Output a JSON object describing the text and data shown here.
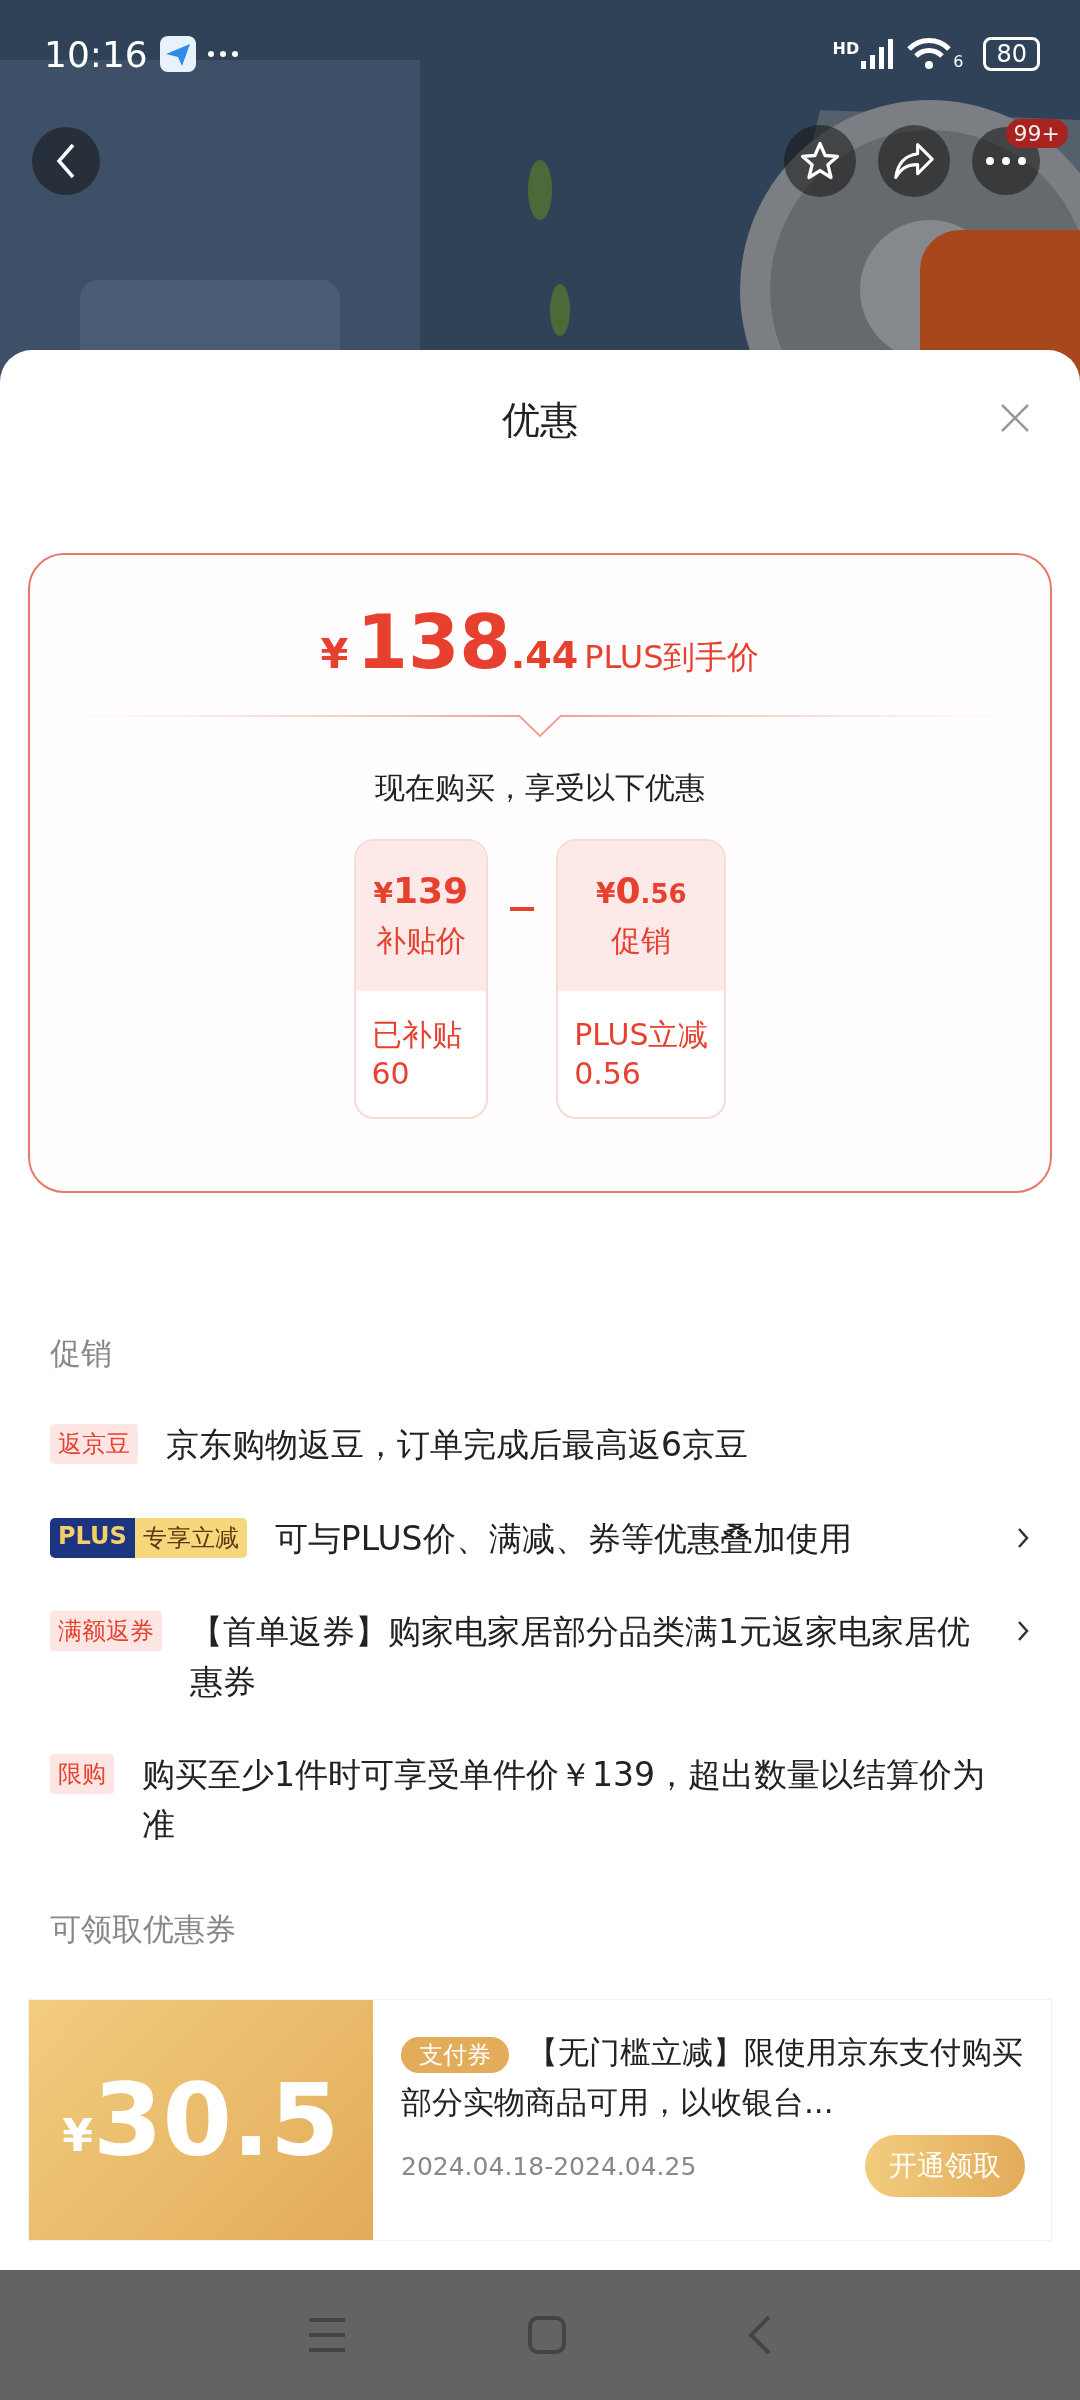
{
  "status_bar": {
    "time": "10:16",
    "network": "HD",
    "wifi_band": "6",
    "battery": "80"
  },
  "top_actions": {
    "more_badge": "99+"
  },
  "sheet": {
    "title": "优惠"
  },
  "price_card": {
    "currency": "¥",
    "integer": "138",
    "decimal": ".44",
    "label": "PLUS到手价",
    "subtitle": "现在购买，享受以下优惠",
    "items": [
      {
        "currency": "¥",
        "integer": "139",
        "label": "补贴价",
        "detail_lines": [
          "已补贴",
          "60"
        ]
      },
      {
        "currency": "¥",
        "integer": "0",
        "decimal": ".56",
        "label": "促销",
        "detail_lines": [
          "PLUS立减",
          "0.56"
        ]
      }
    ]
  },
  "promotions": {
    "title": "促销",
    "items": [
      {
        "kind": "tag",
        "tag": "返京豆",
        "text": "京东购物返豆，订单完成后最高返6京豆",
        "has_arrow": false
      },
      {
        "kind": "plus",
        "plus_label": "PLUS",
        "tag": "专享立减",
        "text": "可与PLUS价、满减、券等优惠叠加使用",
        "has_arrow": true
      },
      {
        "kind": "tag",
        "tag": "满额返券",
        "text": "【首单返券】购家电家居部分品类满1元返家电家居优惠券",
        "has_arrow": true
      },
      {
        "kind": "tag",
        "tag": "限购",
        "text": "购买至少1件时可享受单件价￥139，超出数量以结算价为准",
        "has_arrow": false
      }
    ]
  },
  "coupons": {
    "title": "可领取优惠券",
    "items": [
      {
        "currency": "¥",
        "amount": "30.5",
        "tag": "支付券",
        "text": "【无门槛立减】限使用京东支付购买部分实物商品可用，以收银台...",
        "dates": "2024.04.18-2024.04.25",
        "button": "开通领取"
      }
    ]
  }
}
